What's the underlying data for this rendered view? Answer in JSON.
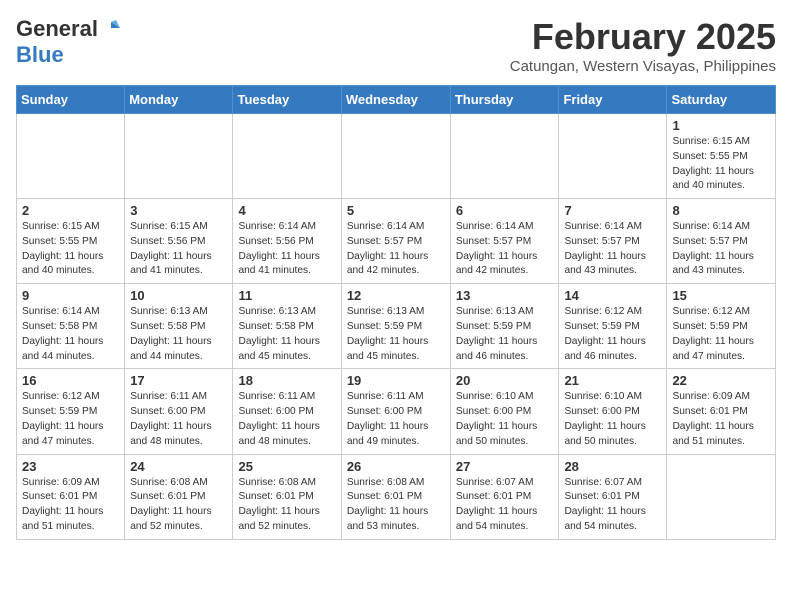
{
  "header": {
    "logo_line1": "General",
    "logo_line2": "Blue",
    "month": "February 2025",
    "location": "Catungan, Western Visayas, Philippines"
  },
  "weekdays": [
    "Sunday",
    "Monday",
    "Tuesday",
    "Wednesday",
    "Thursday",
    "Friday",
    "Saturday"
  ],
  "weeks": [
    [
      {
        "day": "",
        "info": ""
      },
      {
        "day": "",
        "info": ""
      },
      {
        "day": "",
        "info": ""
      },
      {
        "day": "",
        "info": ""
      },
      {
        "day": "",
        "info": ""
      },
      {
        "day": "",
        "info": ""
      },
      {
        "day": "1",
        "info": "Sunrise: 6:15 AM\nSunset: 5:55 PM\nDaylight: 11 hours\nand 40 minutes."
      }
    ],
    [
      {
        "day": "2",
        "info": "Sunrise: 6:15 AM\nSunset: 5:55 PM\nDaylight: 11 hours\nand 40 minutes."
      },
      {
        "day": "3",
        "info": "Sunrise: 6:15 AM\nSunset: 5:56 PM\nDaylight: 11 hours\nand 41 minutes."
      },
      {
        "day": "4",
        "info": "Sunrise: 6:14 AM\nSunset: 5:56 PM\nDaylight: 11 hours\nand 41 minutes."
      },
      {
        "day": "5",
        "info": "Sunrise: 6:14 AM\nSunset: 5:57 PM\nDaylight: 11 hours\nand 42 minutes."
      },
      {
        "day": "6",
        "info": "Sunrise: 6:14 AM\nSunset: 5:57 PM\nDaylight: 11 hours\nand 42 minutes."
      },
      {
        "day": "7",
        "info": "Sunrise: 6:14 AM\nSunset: 5:57 PM\nDaylight: 11 hours\nand 43 minutes."
      },
      {
        "day": "8",
        "info": "Sunrise: 6:14 AM\nSunset: 5:57 PM\nDaylight: 11 hours\nand 43 minutes."
      }
    ],
    [
      {
        "day": "9",
        "info": "Sunrise: 6:14 AM\nSunset: 5:58 PM\nDaylight: 11 hours\nand 44 minutes."
      },
      {
        "day": "10",
        "info": "Sunrise: 6:13 AM\nSunset: 5:58 PM\nDaylight: 11 hours\nand 44 minutes."
      },
      {
        "day": "11",
        "info": "Sunrise: 6:13 AM\nSunset: 5:58 PM\nDaylight: 11 hours\nand 45 minutes."
      },
      {
        "day": "12",
        "info": "Sunrise: 6:13 AM\nSunset: 5:59 PM\nDaylight: 11 hours\nand 45 minutes."
      },
      {
        "day": "13",
        "info": "Sunrise: 6:13 AM\nSunset: 5:59 PM\nDaylight: 11 hours\nand 46 minutes."
      },
      {
        "day": "14",
        "info": "Sunrise: 6:12 AM\nSunset: 5:59 PM\nDaylight: 11 hours\nand 46 minutes."
      },
      {
        "day": "15",
        "info": "Sunrise: 6:12 AM\nSunset: 5:59 PM\nDaylight: 11 hours\nand 47 minutes."
      }
    ],
    [
      {
        "day": "16",
        "info": "Sunrise: 6:12 AM\nSunset: 5:59 PM\nDaylight: 11 hours\nand 47 minutes."
      },
      {
        "day": "17",
        "info": "Sunrise: 6:11 AM\nSunset: 6:00 PM\nDaylight: 11 hours\nand 48 minutes."
      },
      {
        "day": "18",
        "info": "Sunrise: 6:11 AM\nSunset: 6:00 PM\nDaylight: 11 hours\nand 48 minutes."
      },
      {
        "day": "19",
        "info": "Sunrise: 6:11 AM\nSunset: 6:00 PM\nDaylight: 11 hours\nand 49 minutes."
      },
      {
        "day": "20",
        "info": "Sunrise: 6:10 AM\nSunset: 6:00 PM\nDaylight: 11 hours\nand 50 minutes."
      },
      {
        "day": "21",
        "info": "Sunrise: 6:10 AM\nSunset: 6:00 PM\nDaylight: 11 hours\nand 50 minutes."
      },
      {
        "day": "22",
        "info": "Sunrise: 6:09 AM\nSunset: 6:01 PM\nDaylight: 11 hours\nand 51 minutes."
      }
    ],
    [
      {
        "day": "23",
        "info": "Sunrise: 6:09 AM\nSunset: 6:01 PM\nDaylight: 11 hours\nand 51 minutes."
      },
      {
        "day": "24",
        "info": "Sunrise: 6:08 AM\nSunset: 6:01 PM\nDaylight: 11 hours\nand 52 minutes."
      },
      {
        "day": "25",
        "info": "Sunrise: 6:08 AM\nSunset: 6:01 PM\nDaylight: 11 hours\nand 52 minutes."
      },
      {
        "day": "26",
        "info": "Sunrise: 6:08 AM\nSunset: 6:01 PM\nDaylight: 11 hours\nand 53 minutes."
      },
      {
        "day": "27",
        "info": "Sunrise: 6:07 AM\nSunset: 6:01 PM\nDaylight: 11 hours\nand 54 minutes."
      },
      {
        "day": "28",
        "info": "Sunrise: 6:07 AM\nSunset: 6:01 PM\nDaylight: 11 hours\nand 54 minutes."
      },
      {
        "day": "",
        "info": ""
      }
    ]
  ]
}
